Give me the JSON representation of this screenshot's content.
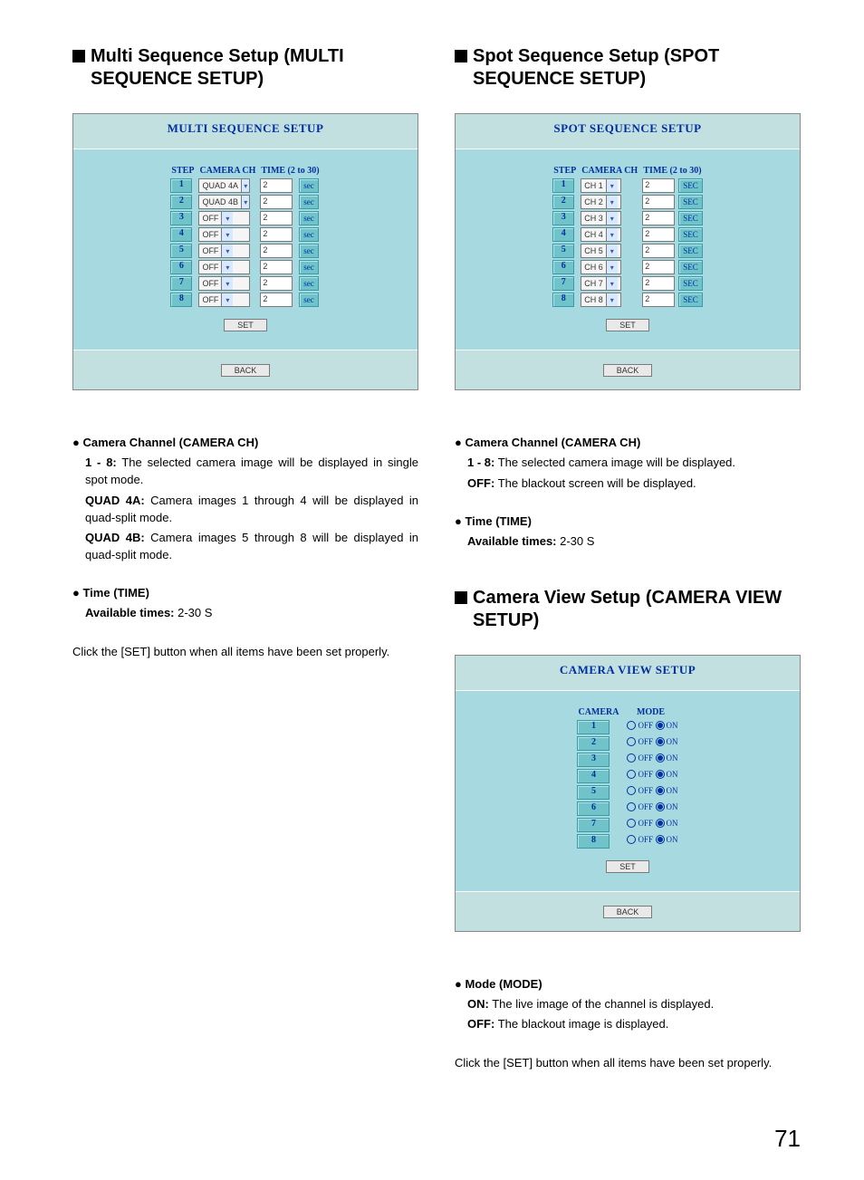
{
  "page_number": "71",
  "left": {
    "heading": "Multi Sequence Setup (MULTI SEQUENCE SETUP)",
    "panel_title": "MULTI SEQUENCE SETUP",
    "col_step": "STEP",
    "col_cam": "CAMERA CH",
    "col_time": "TIME (2 to 30)",
    "rows": [
      {
        "step": "1",
        "cam": "QUAD 4A",
        "time": "2",
        "unit": "sec"
      },
      {
        "step": "2",
        "cam": "QUAD 4B",
        "time": "2",
        "unit": "sec"
      },
      {
        "step": "3",
        "cam": "OFF",
        "time": "2",
        "unit": "sec"
      },
      {
        "step": "4",
        "cam": "OFF",
        "time": "2",
        "unit": "sec"
      },
      {
        "step": "5",
        "cam": "OFF",
        "time": "2",
        "unit": "sec"
      },
      {
        "step": "6",
        "cam": "OFF",
        "time": "2",
        "unit": "sec"
      },
      {
        "step": "7",
        "cam": "OFF",
        "time": "2",
        "unit": "sec"
      },
      {
        "step": "8",
        "cam": "OFF",
        "time": "2",
        "unit": "sec"
      }
    ],
    "btn_set": "SET",
    "btn_back": "BACK",
    "camch_head": "Camera Channel (CAMERA CH)",
    "camch_1_term": "1 - 8:",
    "camch_1_text": " The selected camera image will be displayed in single spot mode.",
    "camch_2_term": "QUAD 4A:",
    "camch_2_text": " Camera images 1 through 4 will be displayed in quad-split mode.",
    "camch_3_term": "QUAD 4B:",
    "camch_3_text": " Camera images 5 through 8 will be displayed in quad-split mode.",
    "time_head": "Time (TIME)",
    "time_term": "Available times:",
    "time_text": " 2-30 S",
    "set_note": "Click the [SET] button when all items have been set properly."
  },
  "right_top": {
    "heading": "Spot Sequence Setup (SPOT SEQUENCE SETUP)",
    "panel_title": "SPOT SEQUENCE SETUP",
    "col_step": "STEP",
    "col_cam": "CAMERA CH",
    "col_time": "TIME (2 to 30)",
    "rows": [
      {
        "step": "1",
        "cam": "CH 1",
        "time": "2",
        "unit": "SEC"
      },
      {
        "step": "2",
        "cam": "CH 2",
        "time": "2",
        "unit": "SEC"
      },
      {
        "step": "3",
        "cam": "CH 3",
        "time": "2",
        "unit": "SEC"
      },
      {
        "step": "4",
        "cam": "CH 4",
        "time": "2",
        "unit": "SEC"
      },
      {
        "step": "5",
        "cam": "CH 5",
        "time": "2",
        "unit": "SEC"
      },
      {
        "step": "6",
        "cam": "CH 6",
        "time": "2",
        "unit": "SEC"
      },
      {
        "step": "7",
        "cam": "CH 7",
        "time": "2",
        "unit": "SEC"
      },
      {
        "step": "8",
        "cam": "CH 8",
        "time": "2",
        "unit": "SEC"
      }
    ],
    "btn_set": "SET",
    "btn_back": "BACK",
    "camch_head": "Camera Channel (CAMERA CH)",
    "camch_1_term": "1 - 8:",
    "camch_1_text": " The selected camera image will be displayed.",
    "camch_2_term": "OFF:",
    "camch_2_text": " The blackout screen will be displayed.",
    "time_head": "Time (TIME)",
    "time_term": "Available times:",
    "time_text": " 2-30 S"
  },
  "right_bottom": {
    "heading": "Camera View Setup (CAMERA VIEW SETUP)",
    "panel_title": "CAMERA VIEW SETUP",
    "col_cam": "CAMERA",
    "col_mode": "MODE",
    "opt_off": "OFF",
    "opt_on": "ON",
    "rows": [
      "1",
      "2",
      "3",
      "4",
      "5",
      "6",
      "7",
      "8"
    ],
    "btn_set": "SET",
    "btn_back": "BACK",
    "mode_head": "Mode (MODE)",
    "mode_1_term": "ON:",
    "mode_1_text": " The live image of the channel is displayed.",
    "mode_2_term": "OFF:",
    "mode_2_text": " The blackout image is displayed.",
    "set_note": "Click the [SET] button when all items have been set properly."
  }
}
